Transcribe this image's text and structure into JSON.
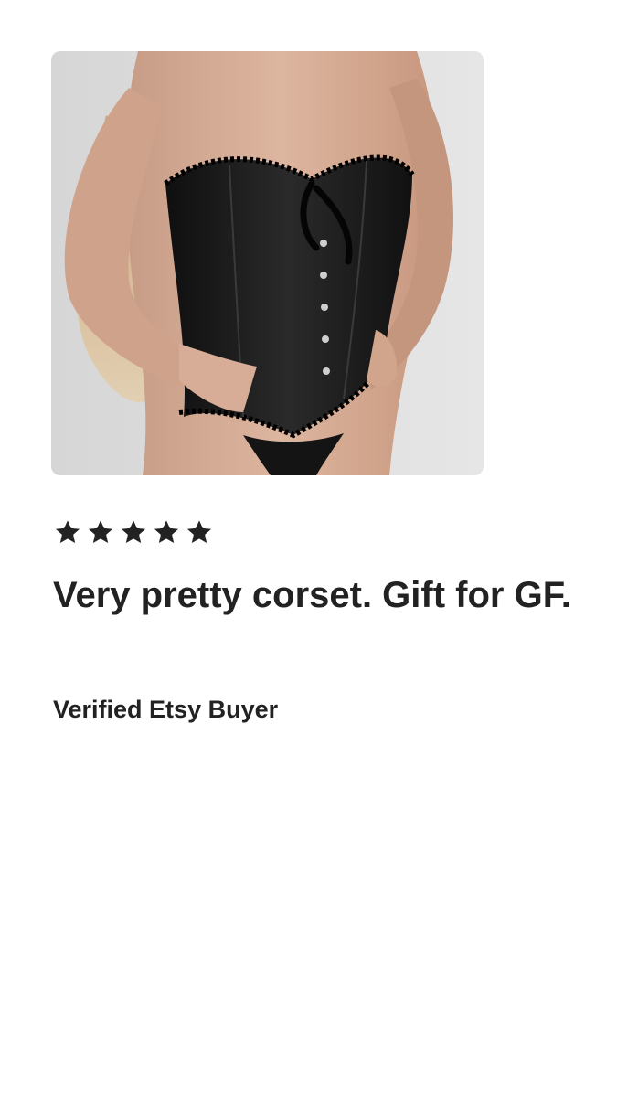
{
  "review": {
    "photo_alt": "corset-product-photo",
    "rating": 5,
    "rating_max": 5,
    "star_icon": "star-filled-icon",
    "star_color": "#222222",
    "text": "Very pretty corset. Gift for GF.",
    "reviewer": "Verified Etsy Buyer"
  }
}
